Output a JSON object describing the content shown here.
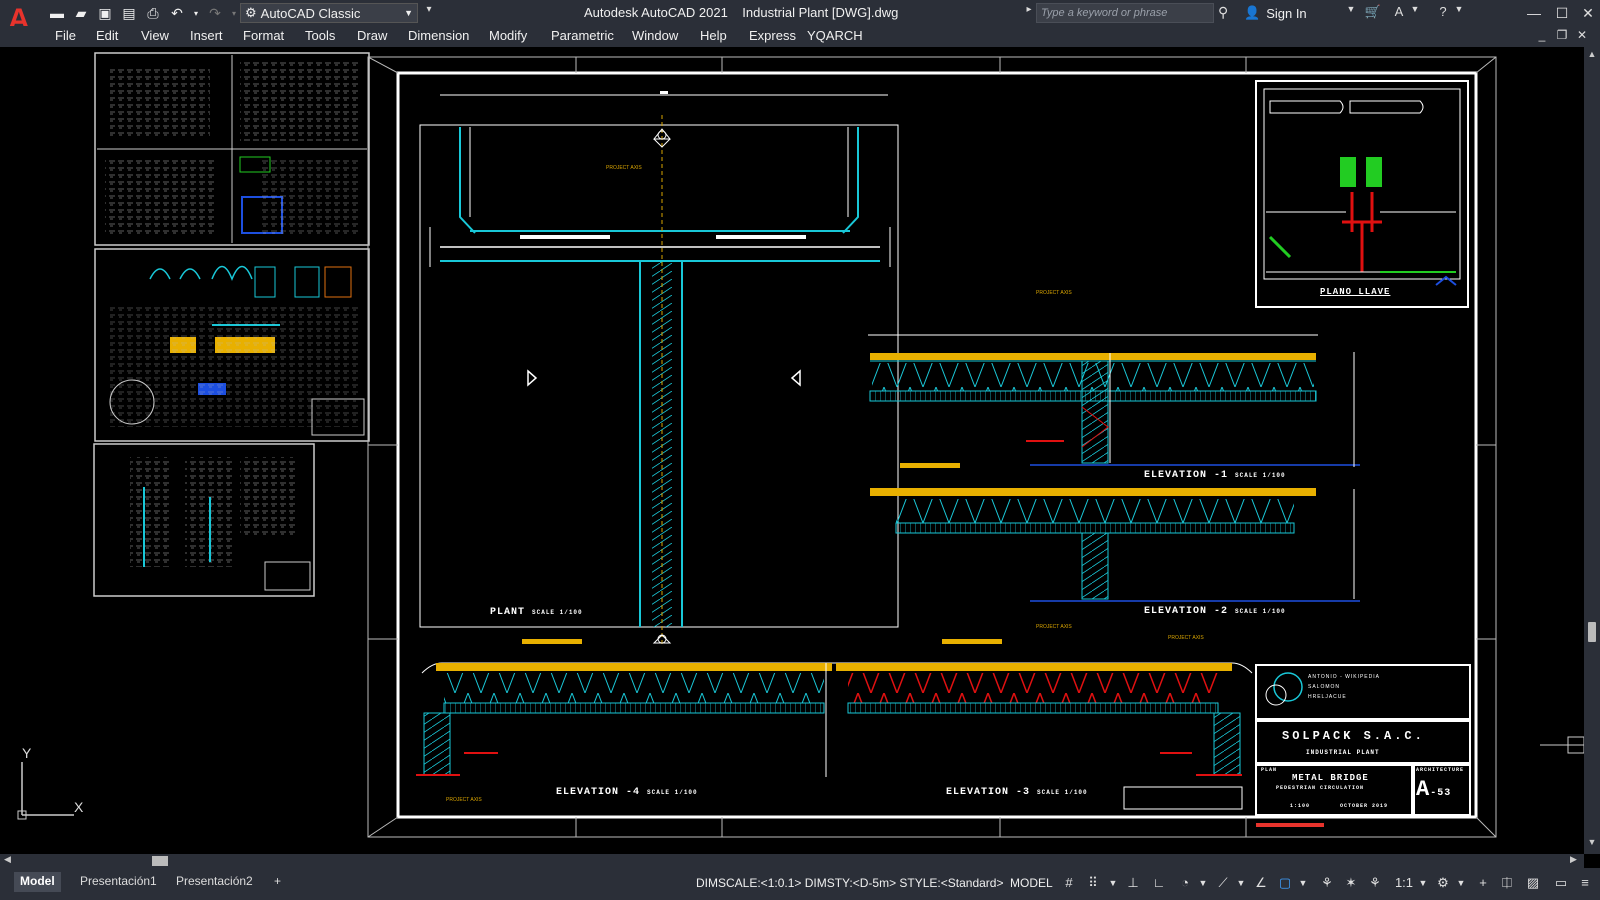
{
  "app": {
    "logo": "A",
    "title": "Autodesk AutoCAD 2021    Industrial Plant [DWG].dwg",
    "workspace": "AutoCAD Classic",
    "search_placeholder": "Type a keyword or phrase",
    "signin": "Sign In"
  },
  "menu": [
    "File",
    "Edit",
    "View",
    "Insert",
    "Format",
    "Tools",
    "Draw",
    "Dimension",
    "Modify",
    "Parametric",
    "Window",
    "Help",
    "Express",
    "YQARCH"
  ],
  "drawing": {
    "plan_label": "PLANT",
    "plan_scale": "SCALE 1/100",
    "elev1_label": "ELEVATION -1",
    "elev1_scale": "SCALE 1/100",
    "elev2_label": "ELEVATION -2",
    "elev2_scale": "SCALE 1/100",
    "elev3_label": "ELEVATION -3",
    "elev3_scale": "SCALE 1/100",
    "elev4_label": "ELEVATION -4",
    "elev4_scale": "SCALE 1/100",
    "key_plan": "PLANO  LLAVE",
    "project_axis": "PROJECT AXIS",
    "company": "SOLPACK  S.A.C.",
    "project": "INDUSTRIAL PLANT",
    "sheet_title": "METAL BRIDGE",
    "sheet_subtitle": "PEDESTRIAN CIRCULATION",
    "sheet_number": "A",
    "sheet_suffix": "-53",
    "sheet_discipline": "ARCHITECTURE",
    "sheet_plan": "PLAN",
    "scale": "1:100",
    "date": "OCTOBER 2019",
    "author_line1": "ANTONIO - WIKIPEDIA",
    "author_line2": "SALOMON",
    "author_line3": "HRELJACUE",
    "ucs_y": "Y",
    "ucs_x": "X"
  },
  "tabs": [
    "Model",
    "Presentación1",
    "Presentación2"
  ],
  "tab_add": "+",
  "status": {
    "text": "DIMSCALE:<1:0.1> DIMSTY:<D-5m> STYLE:<Standard>",
    "model": "MODEL",
    "scale": "1:1"
  },
  "colors": {
    "accent_red": "#e8332c",
    "cad_cyan": "#19c8d8",
    "cad_yellow": "#e8b000",
    "cad_white": "#ffffff",
    "cad_red": "#e01010",
    "cad_green": "#22cc22",
    "cad_blue": "#1d4fe0"
  }
}
